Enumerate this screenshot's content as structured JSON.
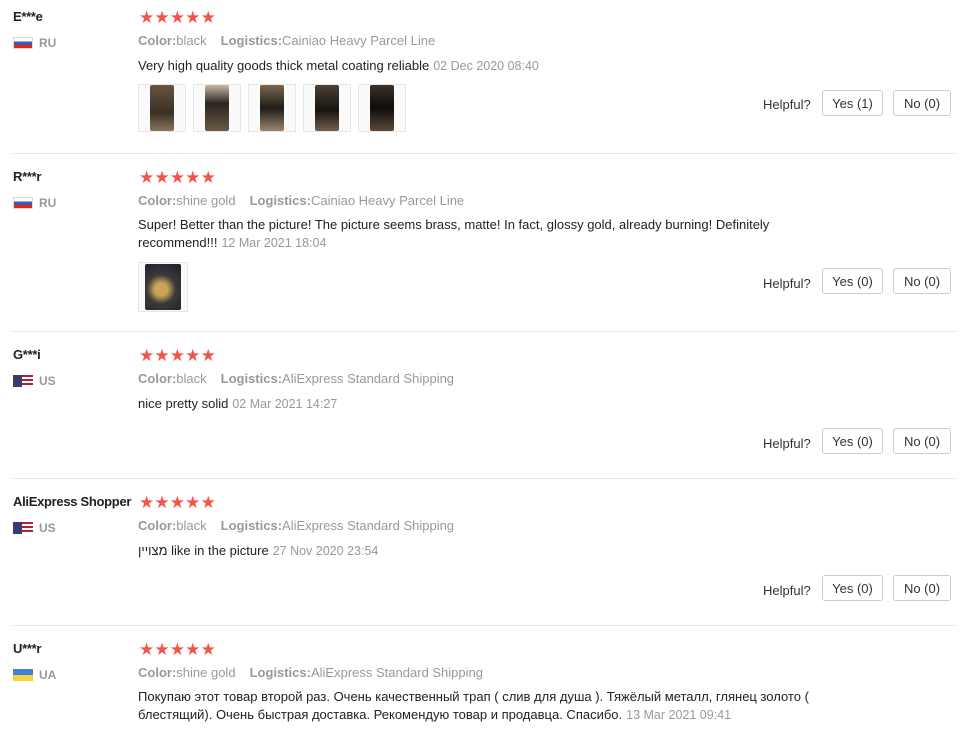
{
  "helpful_label": "Helpful?",
  "color_label": "Color:",
  "logistics_label": "Logistics:",
  "reviews": [
    {
      "name": "E***e",
      "country": "RU",
      "rating": 5,
      "color": "black",
      "logistics": "Cainiao Heavy Parcel Line",
      "text": "Very high quality goods thick metal coating reliable",
      "date": "02 Dec 2020 08:40",
      "yes": "Yes (1)",
      "no": "No (0)"
    },
    {
      "name": "R***r",
      "country": "RU",
      "rating": 5,
      "color": "shine gold",
      "logistics": "Cainiao Heavy Parcel Line",
      "text": "Super! Better than the picture! The picture seems brass, matte! In fact, glossy gold, already burning! Definitely recommend!!!",
      "date": "12 Mar 2021 18:04",
      "yes": "Yes (0)",
      "no": "No (0)"
    },
    {
      "name": "G***i",
      "country": "US",
      "rating": 5,
      "color": "black",
      "logistics": "AliExpress Standard Shipping",
      "text": "nice pretty solid",
      "date": "02 Mar 2021 14:27",
      "yes": "Yes (0)",
      "no": "No (0)"
    },
    {
      "name": "AliExpress Shopper",
      "country": "US",
      "rating": 5,
      "color": "black",
      "logistics": "AliExpress Standard Shipping",
      "text": "מצויין like in the picture",
      "date": "27 Nov 2020 23:54",
      "yes": "Yes (0)",
      "no": "No (0)"
    },
    {
      "name": "U***r",
      "country": "UA",
      "rating": 5,
      "color": "shine gold",
      "logistics": "AliExpress Standard Shipping",
      "text": "Покупаю этот товар второй раз. Очень качественный трап ( слив для душа ). Тяжёлый металл, глянец золото ( блестящий). Очень быстрая доставка. Рекомендую товар и продавца. Спасибо.",
      "date": "13 Mar 2021 09:41"
    }
  ],
  "colors": {
    "star": "#f2564a",
    "muted": "#999999",
    "border": "#cccccc"
  },
  "icons": {
    "star": "star-icon",
    "flag_ru": "flag-ru-icon",
    "flag_us": "flag-us-icon",
    "flag_ua": "flag-ua-icon"
  }
}
